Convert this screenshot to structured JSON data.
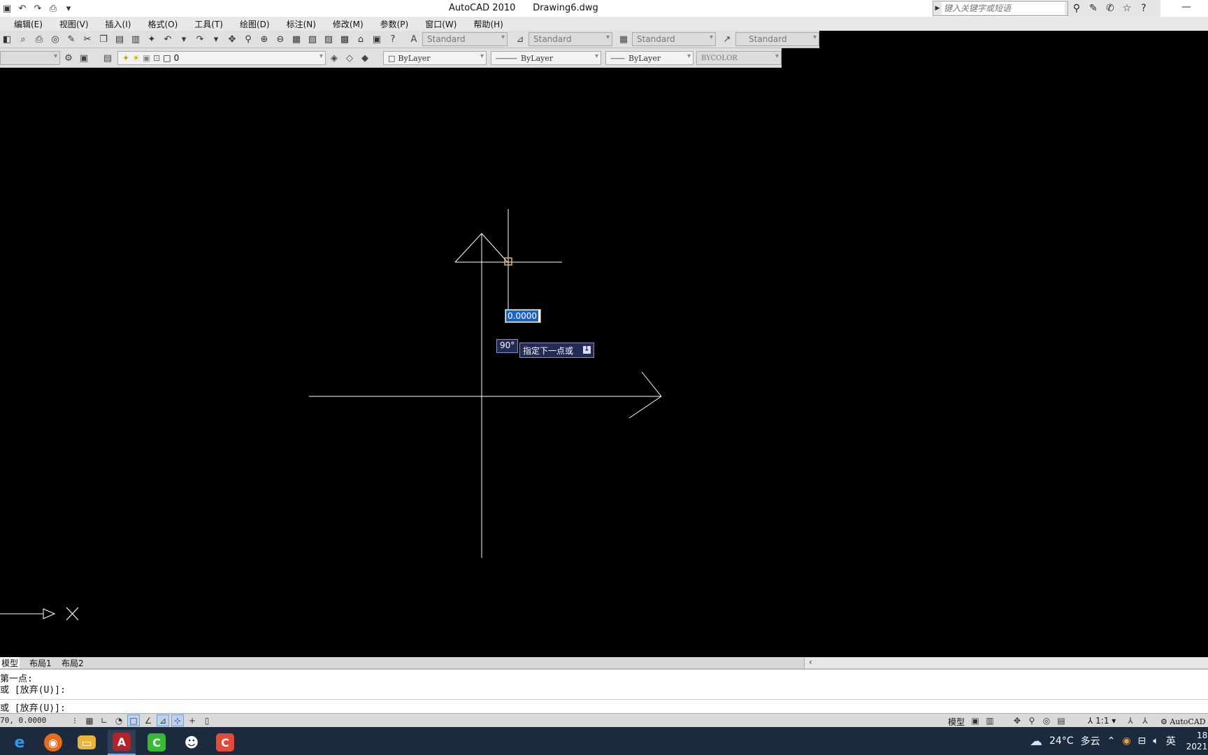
{
  "window": {
    "app_name": "AutoCAD 2010",
    "file_name": "Drawing6.dwg",
    "search_placeholder": "键入关键字或短语"
  },
  "menu": [
    "编辑(E)",
    "视图(V)",
    "插入(I)",
    "格式(O)",
    "工具(T)",
    "绘图(D)",
    "标注(N)",
    "修改(M)",
    "参数(P)",
    "窗口(W)",
    "帮助(H)"
  ],
  "styles_toolbar": {
    "text_style": "Standard",
    "dim_style": "Standard",
    "table_style": "Standard",
    "mleader_style": "Standard"
  },
  "layers_toolbar": {
    "layer_name": "0",
    "color": "ByLayer",
    "linetype": "ByLayer",
    "lineweight": "ByLayer",
    "plot_style": "BYCOLOR"
  },
  "canvas": {
    "dynamic_input_value": "0.0000",
    "angle_tooltip": "90°",
    "prompt_tooltip": "指定下一点或",
    "bg_color": "#000000",
    "line_color": "#ffffff"
  },
  "layout_tabs": [
    "模型",
    "布局1",
    "布局2"
  ],
  "command": {
    "line1": "第一点:",
    "line2": "或 [放弃(U)]:",
    "line3": "或 [放弃(U)]:"
  },
  "status": {
    "coordinates": "70, 0.0000",
    "model_label": "模型",
    "annotation_scale": "1:1",
    "workspace": "AutoCAD 经典"
  },
  "taskbar": {
    "weather_temp": "24°C",
    "weather_desc": "多云",
    "ime": "英",
    "clock_time": "18",
    "clock_date": "2021"
  },
  "icons": {
    "search": "binoculars-icon",
    "help": "question-icon",
    "favorites": "star-icon"
  }
}
